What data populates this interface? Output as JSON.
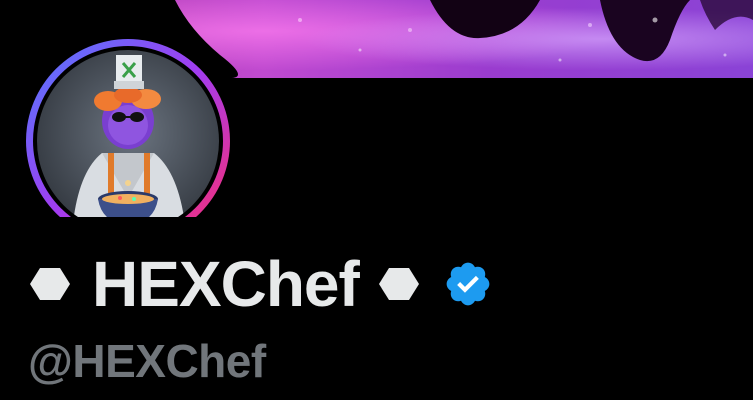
{
  "profile": {
    "display_name": "HEXChef",
    "handle": "@HEXChef",
    "verified": true,
    "name_decoration_icon": "hexagon-icon",
    "verified_icon": "verified-badge-icon"
  },
  "banner": {
    "description_icon": "purple-abstract-banner"
  },
  "avatar": {
    "ring_colors": [
      "#4f7cff",
      "#a23cf0",
      "#ff2d6b"
    ],
    "icon": "chef-character-avatar"
  },
  "colors": {
    "background": "#000000",
    "name": "#e7e9ea",
    "handle": "#71767b",
    "verified": "#1d9bf0"
  }
}
